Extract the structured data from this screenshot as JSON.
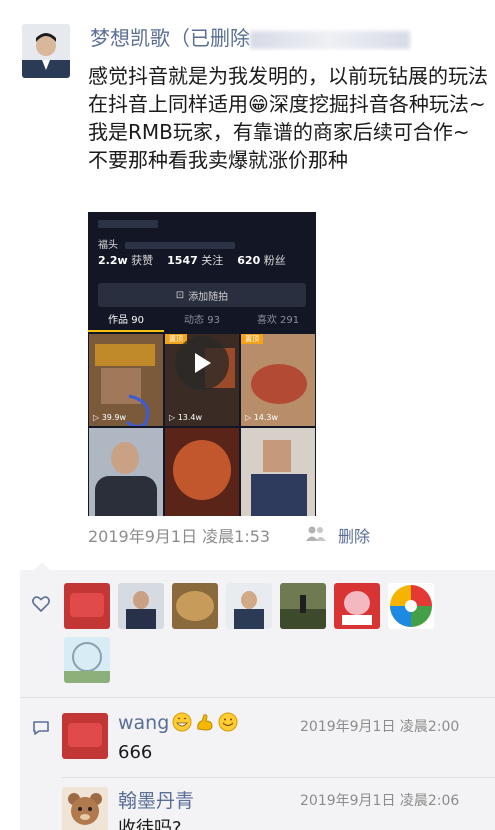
{
  "post": {
    "author_name": "梦想凯歌（已删除",
    "text": "感觉抖音就是为我发明的，以前玩钻展的玩法在抖音上同样适用😁深度挖掘抖音各种玩法~我是RMB玩家，有靠谱的商家后续可合作~不要那种看我卖爆就涨价那种",
    "timestamp": "2019年9月1日 凌晨1:53",
    "delete_label": "删除"
  },
  "screenshot": {
    "small_tag": "福头",
    "stats": {
      "likes": "2.2w",
      "likes_label": "获赞",
      "following": "1547",
      "following_label": "关注",
      "fans": "620",
      "fans_label": "粉丝"
    },
    "add_button": "添加随拍",
    "tabs": [
      {
        "label": "作品 90"
      },
      {
        "label": "动态 93"
      },
      {
        "label": "喜欢 291"
      }
    ],
    "counts": [
      "39.9w",
      "13.4w",
      "14.3w"
    ],
    "badges": [
      "置顶",
      "置顶"
    ]
  },
  "likes": {
    "icon": "heart-outline-icon"
  },
  "comments": [
    {
      "name": "wang",
      "time": "2019年9月1日 凌晨2:00",
      "text": "666"
    },
    {
      "name": "翰墨丹青",
      "time": "2019年9月1日 凌晨2:06",
      "text": "收徒吗?"
    }
  ],
  "colors": {
    "name_link": "#5a6e96",
    "meta_gray": "#8c8c8c",
    "panel_bg": "#f3f3f5",
    "screenshot_bg": "#131725"
  }
}
